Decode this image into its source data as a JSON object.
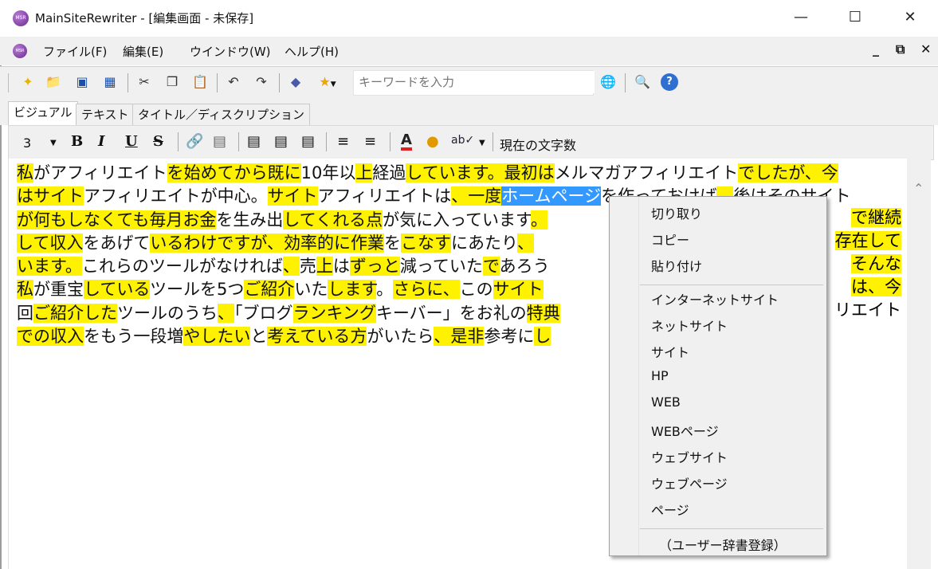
{
  "window": {
    "title": "MainSiteRewriter - [編集画面 - 未保存]",
    "icon": "msr-logo-icon",
    "icon_text": "MSR"
  },
  "menu": [
    "ファイル(F)",
    "編集(E)",
    "ウインドウ(W)",
    "ヘルプ(H)"
  ],
  "toolbar": {
    "search_placeholder": "キーワードを入力"
  },
  "tabs": [
    "ビジュアル",
    "テキスト",
    "タイトル／ディスクリプション"
  ],
  "format": {
    "font_size": "3",
    "bold": "B",
    "italic": "I",
    "underline": "U",
    "strike": "S",
    "font_color_glyph": "A",
    "char_count_label": "現在の文字数"
  },
  "editor_text": [
    [
      [
        "私",
        "h"
      ],
      [
        "がアフィリエイト",
        ""
      ],
      [
        "を始めて",
        "h"
      ],
      [
        "から",
        "h"
      ],
      [
        "既に",
        "h"
      ],
      [
        "10年以",
        ""
      ],
      [
        "上",
        "h"
      ],
      [
        "経過",
        ""
      ],
      [
        "しています。",
        "h"
      ],
      [
        "最初は",
        "h"
      ],
      [
        "メルマガアフィリエイト",
        ""
      ],
      [
        "でしたが、",
        "h"
      ],
      [
        "今",
        "h"
      ]
    ],
    [
      [
        "は",
        "h"
      ],
      [
        "サイト",
        "h"
      ],
      [
        "アフィリエイトが中心。",
        ""
      ],
      [
        "サイト",
        "h"
      ],
      [
        "アフィリエイトは",
        ""
      ],
      [
        "、",
        "h"
      ],
      [
        "一度",
        "h"
      ],
      [
        "ホームページ",
        "s"
      ],
      [
        "を作っておけば",
        ""
      ],
      [
        "、",
        "h"
      ],
      [
        "後はそのサイト",
        ""
      ]
    ],
    [
      [
        "が",
        "h"
      ],
      [
        "何もしなくても",
        "h"
      ],
      [
        "毎月",
        "h"
      ],
      [
        "お金",
        "h"
      ],
      [
        "を生み出",
        ""
      ],
      [
        "してくれる",
        "h"
      ],
      [
        "点",
        "h"
      ],
      [
        "が気に入っています",
        ""
      ],
      [
        "。",
        "h"
      ]
    ],
    [
      [
        "して",
        "h"
      ],
      [
        "収入",
        "h"
      ],
      [
        "をあげて",
        ""
      ],
      [
        "いる",
        "h"
      ],
      [
        "わけ",
        "h"
      ],
      [
        "ですが",
        "h"
      ],
      [
        "、",
        "h"
      ],
      [
        "効率的に",
        "h"
      ],
      [
        "作業",
        "h"
      ],
      [
        "を",
        ""
      ],
      [
        "こなす",
        "h"
      ],
      [
        "にあたり",
        ""
      ],
      [
        "、",
        "h"
      ]
    ],
    [
      [
        "います。",
        "h"
      ],
      [
        "これらのツールがなければ",
        ""
      ],
      [
        "、",
        "h"
      ],
      [
        "売",
        ""
      ],
      [
        "上",
        "h"
      ],
      [
        "は",
        ""
      ],
      [
        "ずっと",
        "h"
      ],
      [
        "減っていた",
        ""
      ],
      [
        "で",
        "h"
      ],
      [
        "あろう",
        ""
      ]
    ],
    [
      [
        "私",
        "h"
      ],
      [
        "が重宝",
        ""
      ],
      [
        "している",
        "h"
      ],
      [
        "ツールを5つ",
        ""
      ],
      [
        "ご紹介",
        "h"
      ],
      [
        "いた",
        ""
      ],
      [
        "します",
        "h"
      ],
      [
        "。",
        ""
      ],
      [
        "さらに",
        "h"
      ],
      [
        "、",
        "h"
      ],
      [
        "この",
        ""
      ],
      [
        "サイト",
        "h"
      ]
    ],
    [
      [
        "回",
        ""
      ],
      [
        "ご紹介",
        "h"
      ],
      [
        "した",
        "h"
      ],
      [
        "ツールのうち",
        ""
      ],
      [
        "、",
        "h"
      ],
      [
        "「ブログ",
        ""
      ],
      [
        "ランキング",
        "h"
      ],
      [
        "キーバー」をお礼の",
        ""
      ],
      [
        "特典",
        "h"
      ]
    ],
    [
      [
        "での",
        "h"
      ],
      [
        "収入",
        "h"
      ],
      [
        "をもう一段増",
        ""
      ],
      [
        "や",
        "h"
      ],
      [
        "したい",
        "h"
      ],
      [
        "と",
        ""
      ],
      [
        "考えている",
        "h"
      ],
      [
        "方",
        "h"
      ],
      [
        "がいたら",
        ""
      ],
      [
        "、",
        "h"
      ],
      [
        "是非",
        "h"
      ],
      [
        "参考に",
        ""
      ],
      [
        "し",
        "h"
      ]
    ]
  ],
  "editor_tail": [
    [
      [
        "",
        "h"
      ]
    ],
    [
      [
        "",
        "h"
      ]
    ],
    [
      [
        "で",
        "h"
      ],
      [
        "継続",
        "h"
      ]
    ],
    [
      [
        "存在して",
        "h"
      ]
    ],
    [
      [
        "そんな",
        "h"
      ]
    ],
    [
      [
        "は",
        "h"
      ],
      [
        "、",
        "h"
      ],
      [
        "今",
        "h"
      ]
    ],
    [
      [
        "リエイト",
        ""
      ]
    ]
  ],
  "context_menu": {
    "group1": [
      "切り取り",
      "コピー",
      "貼り付け"
    ],
    "group2": [
      "インターネットサイト",
      "ネットサイト",
      "サイト",
      "HP",
      "WEB",
      "WEBページ",
      "ウェブサイト",
      "ウェブページ",
      "ページ"
    ],
    "group3": [
      "（ユーザー辞書登録）"
    ]
  }
}
